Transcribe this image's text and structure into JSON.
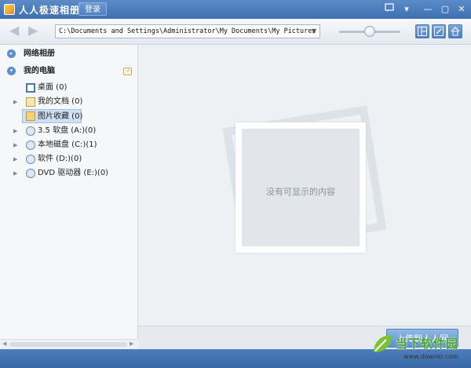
{
  "window": {
    "title": "人人极速相册",
    "login_label": "登录"
  },
  "toolbar": {
    "path": "C:\\Documents and Settings\\Administrator\\My Documents\\My Pictures"
  },
  "sidebar": {
    "sections": [
      {
        "label": "网络相册"
      },
      {
        "label": "我的电脑"
      }
    ],
    "items": [
      {
        "label": "桌面 (0)"
      },
      {
        "label": "我的文档 (0)"
      },
      {
        "label": "图片收藏 (0)"
      },
      {
        "label": "3.5 软盘 (A:)(0)"
      },
      {
        "label": "本地磁盘 (C:)(1)"
      },
      {
        "label": "软件 (D:)(0)"
      },
      {
        "label": "DVD 驱动器 (E:)(0)"
      }
    ]
  },
  "main": {
    "empty_message": "没有可显示的内容",
    "upload_label": "上传到人人网"
  },
  "watermark": {
    "text1": "当下软件园",
    "text2": "www.downkr.com"
  },
  "colors": {
    "titlebar": "#3e70b2",
    "accent": "#5b8fcf",
    "selected": "#cfe0f5"
  }
}
